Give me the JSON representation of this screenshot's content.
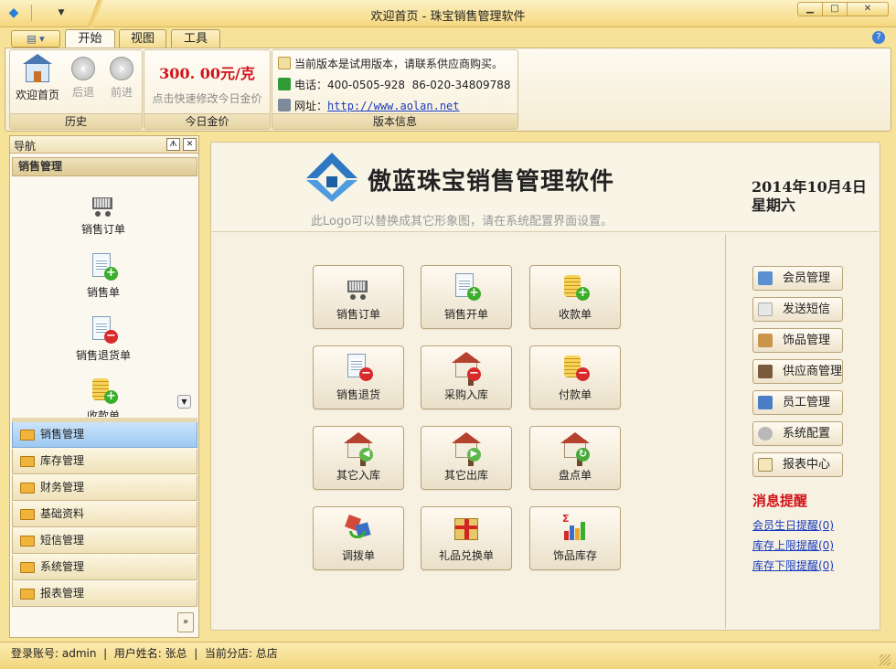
{
  "window": {
    "title": "欢迎首页 - 珠宝销售管理软件"
  },
  "tabs": [
    {
      "label": "开始"
    },
    {
      "label": "视图"
    },
    {
      "label": "工具"
    }
  ],
  "ribbon": {
    "history": {
      "home_label": "欢迎首页",
      "back_label": "后退",
      "forward_label": "前进",
      "group_label": "历史"
    },
    "gold": {
      "price": "300. 00元/克",
      "hint": "点击快速修改今日金价",
      "group_label": "今日金价"
    },
    "version": {
      "notice": "当前版本是试用版本，请联系供应商购买。",
      "phone_label": "电话：",
      "phone_value": "400-0505-928  86-020-34809788",
      "site_label": "网址：",
      "site_url": "http://www.aolan.net",
      "group_label": "版本信息"
    }
  },
  "nav": {
    "title": "导航",
    "section": "销售管理",
    "items": [
      {
        "label": "销售订单",
        "icon": "cart-icon"
      },
      {
        "label": "销售单",
        "icon": "sales-doc-add-icon"
      },
      {
        "label": "销售退货单",
        "icon": "sales-return-icon"
      },
      {
        "label": "收款单",
        "icon": "coins-add-icon"
      }
    ],
    "categories": [
      {
        "label": "销售管理",
        "active": true
      },
      {
        "label": "库存管理"
      },
      {
        "label": "财务管理"
      },
      {
        "label": "基础资料"
      },
      {
        "label": "短信管理"
      },
      {
        "label": "系统管理"
      },
      {
        "label": "报表管理"
      }
    ]
  },
  "main": {
    "logo_text": "傲蓝珠宝销售管理软件",
    "logo_hint": "此Logo可以替换成其它形象图，请在系统配置界面设置。",
    "date": "2014年10月4日",
    "weekday": "星期六",
    "tiles": [
      {
        "label": "销售订单",
        "icon": "cart-icon"
      },
      {
        "label": "销售开单",
        "icon": "sales-doc-add-icon"
      },
      {
        "label": "收款单",
        "icon": "coins-add-icon"
      },
      {
        "label": "销售退货",
        "icon": "sales-return-icon"
      },
      {
        "label": "采购入库",
        "icon": "purchase-in-icon"
      },
      {
        "label": "付款单",
        "icon": "coins-minus-icon"
      },
      {
        "label": "其它入库",
        "icon": "other-in-icon"
      },
      {
        "label": "其它出库",
        "icon": "other-out-icon"
      },
      {
        "label": "盘点单",
        "icon": "stocktake-icon"
      },
      {
        "label": "调拨单",
        "icon": "transfer-icon"
      },
      {
        "label": "礼品兑换单",
        "icon": "gift-icon"
      },
      {
        "label": "饰品库存",
        "icon": "chart-bars-icon"
      }
    ],
    "side_buttons": [
      {
        "label": "会员管理",
        "icon": "members-icon"
      },
      {
        "label": "发送短信",
        "icon": "sms-icon"
      },
      {
        "label": "饰品管理",
        "icon": "box-icon"
      },
      {
        "label": "供应商管理",
        "icon": "supplier-icon"
      },
      {
        "label": "员工管理",
        "icon": "employee-icon"
      },
      {
        "label": "系统配置",
        "icon": "config-icon"
      },
      {
        "label": "报表中心",
        "icon": "report-icon"
      }
    ],
    "messages": {
      "title": "消息提醒",
      "links": [
        "会员生日提醒(0)",
        "库存上限提醒(0)",
        "库存下限提醒(0)"
      ]
    }
  },
  "status": {
    "text": "登录账号: admin  |  用户姓名: 张总  |  当前分店: 总店"
  },
  "colors": {
    "accent_red": "#d3131b",
    "link_blue": "#1a3bbf",
    "logo_blue": "#2e78c2",
    "active_nav": "#9dc9f1"
  }
}
